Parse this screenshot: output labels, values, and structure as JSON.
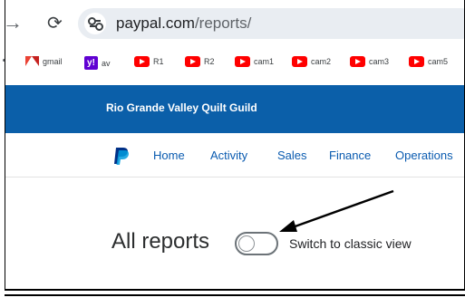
{
  "browser": {
    "url_host": "paypal.com",
    "url_path": "/reports/",
    "bookmarks": [
      "gmail",
      "av",
      "R1",
      "R2",
      "cam1",
      "cam2",
      "cam3",
      "cam5"
    ]
  },
  "brand": {
    "org_name": "Rio Grande Valley Quilt Guild",
    "bar_color": "#0b5fa9"
  },
  "nav": {
    "items": [
      "Home",
      "Activity",
      "Sales",
      "Finance",
      "Operations"
    ]
  },
  "page": {
    "title": "All reports",
    "toggle_label": "Switch to classic view",
    "toggle_on": false
  }
}
